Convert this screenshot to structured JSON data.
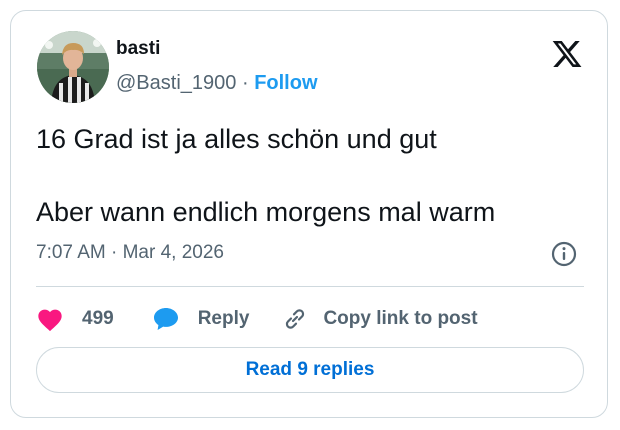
{
  "tweet": {
    "author_name": "basti",
    "handle": "@Basti_1900",
    "separator": "·",
    "follow_label": "Follow",
    "text_line_1": "16 Grad ist ja alles schön und gut",
    "text_line_2": "Aber wann endlich morgens mal warm",
    "timestamp": "7:07 AM · Mar 4, 2026"
  },
  "actions": {
    "like_count": "499",
    "reply_label": "Reply",
    "copy_label": "Copy link to post"
  },
  "footer": {
    "read_replies_label": "Read 9 replies"
  },
  "icons": {
    "logo": "x-logo-icon",
    "info": "info-icon",
    "like": "heart-icon",
    "reply": "speech-bubble-icon",
    "copy": "link-icon"
  },
  "colors": {
    "accent": "#1d9bf0",
    "read_button_text": "#006fd6",
    "like": "#f91880",
    "secondary_text": "#536471",
    "border": "#cfd9de"
  }
}
